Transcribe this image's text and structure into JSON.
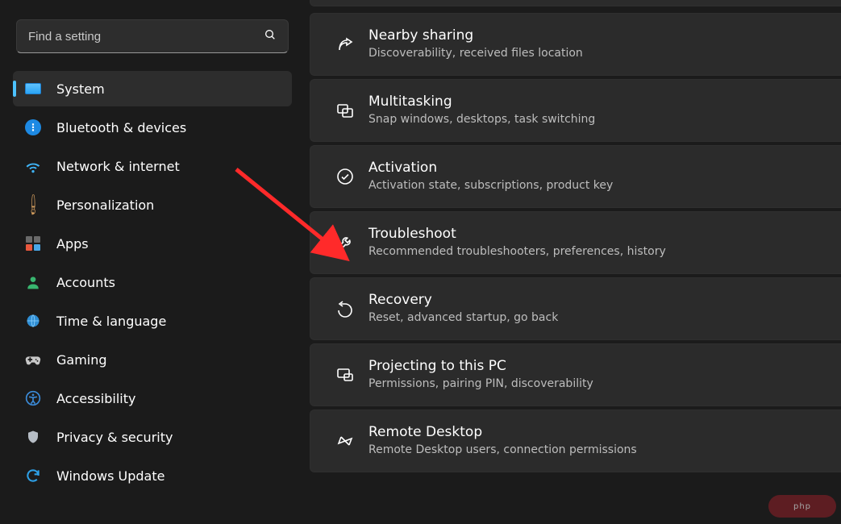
{
  "search": {
    "placeholder": "Find a setting"
  },
  "sidebar": {
    "items": [
      {
        "key": "system",
        "label": "System",
        "selected": true,
        "icon": "ico-system"
      },
      {
        "key": "bt",
        "label": "Bluetooth & devices",
        "selected": false,
        "icon": "ico-bt"
      },
      {
        "key": "net",
        "label": "Network & internet",
        "selected": false,
        "icon": "ico-net"
      },
      {
        "key": "pers",
        "label": "Personalization",
        "selected": false,
        "icon": "ico-pers"
      },
      {
        "key": "apps",
        "label": "Apps",
        "selected": false,
        "icon": "ico-apps"
      },
      {
        "key": "acct",
        "label": "Accounts",
        "selected": false,
        "icon": "ico-acct"
      },
      {
        "key": "time",
        "label": "Time & language",
        "selected": false,
        "icon": "ico-time"
      },
      {
        "key": "game",
        "label": "Gaming",
        "selected": false,
        "icon": "ico-game"
      },
      {
        "key": "acc",
        "label": "Accessibility",
        "selected": false,
        "icon": "ico-acc"
      },
      {
        "key": "priv",
        "label": "Privacy & security",
        "selected": false,
        "icon": "ico-priv"
      },
      {
        "key": "upd",
        "label": "Windows Update",
        "selected": false,
        "icon": "ico-upd"
      }
    ]
  },
  "main": {
    "cards": [
      {
        "key": "nearby",
        "title": "Nearby sharing",
        "desc": "Discoverability, received files location",
        "icon": "share-icon"
      },
      {
        "key": "multi",
        "title": "Multitasking",
        "desc": "Snap windows, desktops, task switching",
        "icon": "windows-icon"
      },
      {
        "key": "activ",
        "title": "Activation",
        "desc": "Activation state, subscriptions, product key",
        "icon": "check-circle-icon"
      },
      {
        "key": "trouble",
        "title": "Troubleshoot",
        "desc": "Recommended troubleshooters, preferences, history",
        "icon": "wrench-icon"
      },
      {
        "key": "recov",
        "title": "Recovery",
        "desc": "Reset, advanced startup, go back",
        "icon": "recovery-icon"
      },
      {
        "key": "proj",
        "title": "Projecting to this PC",
        "desc": "Permissions, pairing PIN, discoverability",
        "icon": "project-icon"
      },
      {
        "key": "rdp",
        "title": "Remote Desktop",
        "desc": "Remote Desktop users, connection permissions",
        "icon": "remote-icon"
      }
    ]
  },
  "annotation": {
    "arrow_color": "#ff2a2a"
  },
  "watermark": "php"
}
